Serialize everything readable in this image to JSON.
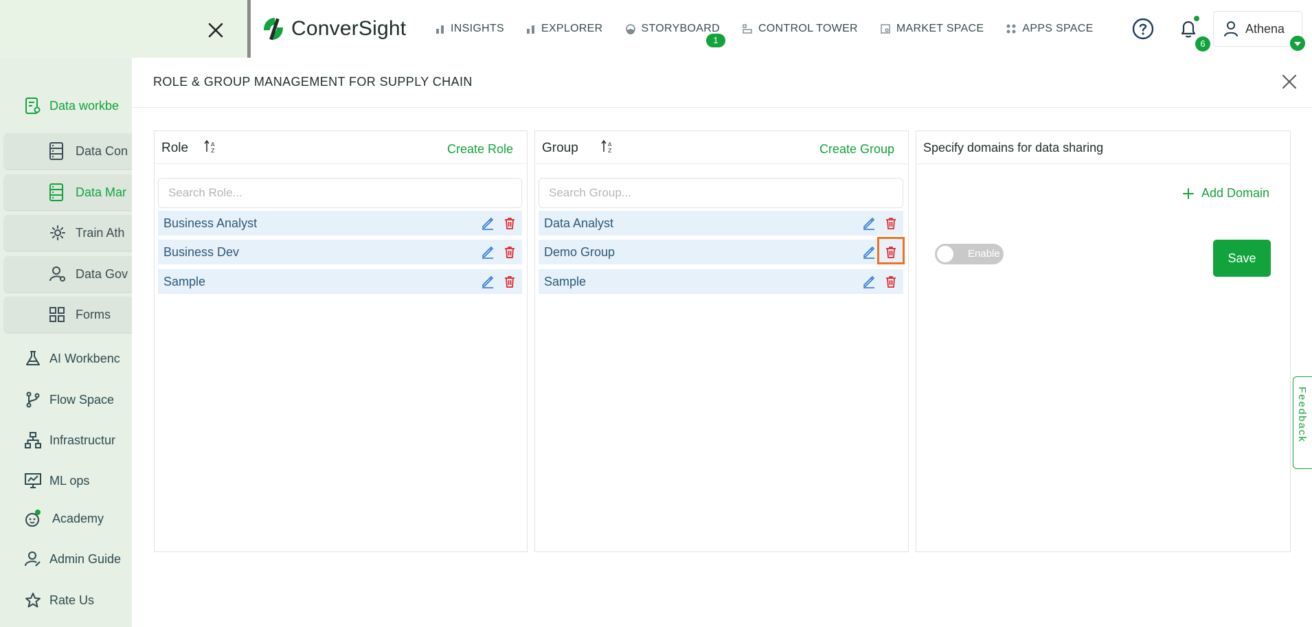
{
  "app": {
    "brand": "ConverSight",
    "brand_color": "#12a33c",
    "highlight_color": "#f37021"
  },
  "topnav": {
    "items": [
      {
        "label": "INSIGHTS",
        "icon": "bar-chart-icon"
      },
      {
        "label": "EXPLORER",
        "icon": "bar-chart-icon"
      },
      {
        "label": "STORYBOARD",
        "icon": "storyboard-icon",
        "badge": "1"
      },
      {
        "label": "CONTROL TOWER",
        "icon": "control-tower-icon"
      },
      {
        "label": "MARKET SPACE",
        "icon": "market-space-icon"
      },
      {
        "label": "APPS SPACE",
        "icon": "apps-space-icon"
      }
    ],
    "notifications_count": "6",
    "user_name": "Athena"
  },
  "sidebar": {
    "top_item": "Data workbe",
    "sub_items": [
      {
        "label": "Data Con",
        "active": false
      },
      {
        "label": "Data Mar",
        "active": true
      },
      {
        "label": "Train Ath",
        "active": false
      },
      {
        "label": "Data Gov",
        "active": false
      },
      {
        "label": "Forms",
        "active": false
      }
    ],
    "main_items": [
      {
        "label": "AI Workbenc"
      },
      {
        "label": "Flow Space"
      },
      {
        "label": "Infrastructur"
      },
      {
        "label": "ML ops"
      },
      {
        "label": "Academy"
      },
      {
        "label": "Admin Guide"
      },
      {
        "label": "Rate Us"
      }
    ]
  },
  "panel": {
    "title": "ROLE & GROUP MANAGEMENT FOR SUPPLY CHAIN",
    "role": {
      "title": "Role",
      "create_label": "Create Role",
      "search_placeholder": "Search Role...",
      "rows": [
        "Business Analyst",
        "Business Dev",
        "Sample"
      ]
    },
    "group": {
      "title": "Group",
      "create_label": "Create Group",
      "search_placeholder": "Search Group...",
      "rows": [
        "Data Analyst",
        "Demo Group",
        "Sample"
      ],
      "highlighted_row": 1
    },
    "domains": {
      "title": "Specify domains for data sharing",
      "add_label": "Add Domain",
      "toggle_label": "Enable",
      "toggle_on": false,
      "save_label": "Save"
    }
  },
  "feedback_label": "Feedback"
}
